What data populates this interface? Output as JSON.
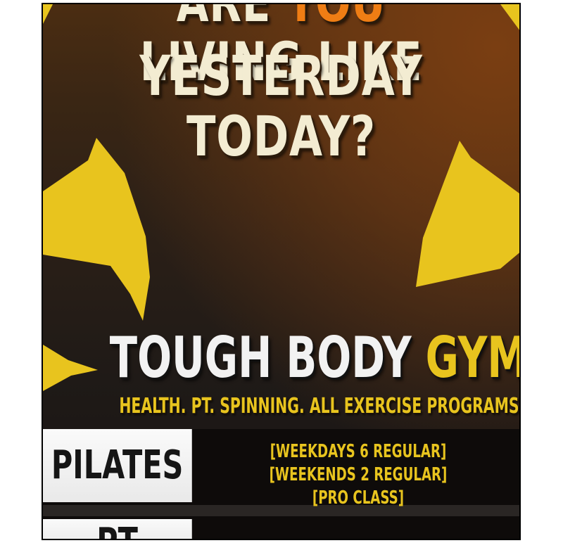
{
  "headline": {
    "line1_part1": "ARE ",
    "line1_highlight": "YOU",
    "line1_part2": " LIVING LIKE",
    "line2": "YESTERDAY TODAY?"
  },
  "gym": {
    "name_part1": "TOUGH BODY ",
    "name_highlight": "GYM",
    "tagline": "HEALTH. PT. SPINNING. ALL EXERCISE PROGRAMS!!"
  },
  "classes": [
    {
      "label": "PILATES",
      "schedule": "[WEEKDAYS 6 REGULAR] [WEEKENDS 2 REGULAR] [PRO CLASS]"
    },
    {
      "label": "PT",
      "schedule": ""
    }
  ],
  "colors": {
    "accent_yellow": "#e8c41e",
    "accent_orange": "#ef7d14",
    "headline_cream": "#f3ecd2",
    "label_bg": "#f0f0f0",
    "band_bg": "#0e0b0a"
  }
}
